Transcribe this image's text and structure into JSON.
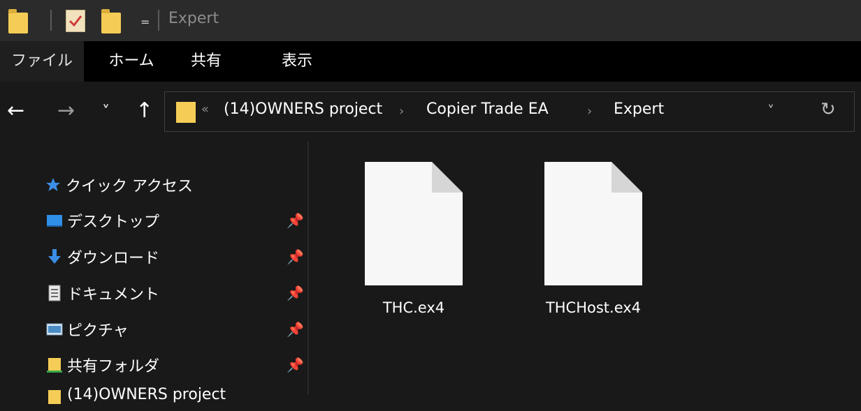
{
  "window": {
    "title": "Expert",
    "quick_access_dropdown": "=",
    "icons": [
      "folder-icon",
      "properties-icon",
      "new-folder-icon",
      "dropdown-icon"
    ]
  },
  "ribbon": {
    "tabs": [
      {
        "label": "ファイル",
        "active": true
      },
      {
        "label": "ホーム"
      },
      {
        "label": "共有"
      },
      {
        "label": "表示"
      }
    ]
  },
  "navigation": {
    "back": "←",
    "forward": "→",
    "recent": "˅",
    "up": "↑"
  },
  "address": {
    "overflow": "«",
    "separator": "›",
    "crumbs": [
      "(14)OWNERS project",
      "Copier Trade EA",
      "Expert"
    ],
    "dropdown": "˅",
    "refresh": "↻"
  },
  "sidebar": {
    "items": [
      {
        "label": "クイック アクセス",
        "icon": "star-icon",
        "pinned": false
      },
      {
        "label": "デスクトップ",
        "icon": "desktop-icon",
        "pinned": true
      },
      {
        "label": "ダウンロード",
        "icon": "download-icon",
        "pinned": true
      },
      {
        "label": "ドキュメント",
        "icon": "document-icon",
        "pinned": true
      },
      {
        "label": "ピクチャ",
        "icon": "pictures-icon",
        "pinned": true
      },
      {
        "label": "共有フォルダ",
        "icon": "shared-folder-icon",
        "pinned": true
      },
      {
        "label": "(14)OWNERS project",
        "icon": "folder-icon",
        "pinned": false
      }
    ],
    "pin_glyph": "📌"
  },
  "files": [
    {
      "name": "THC.ex4",
      "icon": "blank-file-icon"
    },
    {
      "name": "THCHost.ex4",
      "icon": "blank-file-icon"
    }
  ],
  "colors": {
    "background": "#191919",
    "titlebar": "#2b2b2b",
    "ribbon": "#000000",
    "folder": "#f5cd56",
    "star": "#3b8ee6"
  }
}
